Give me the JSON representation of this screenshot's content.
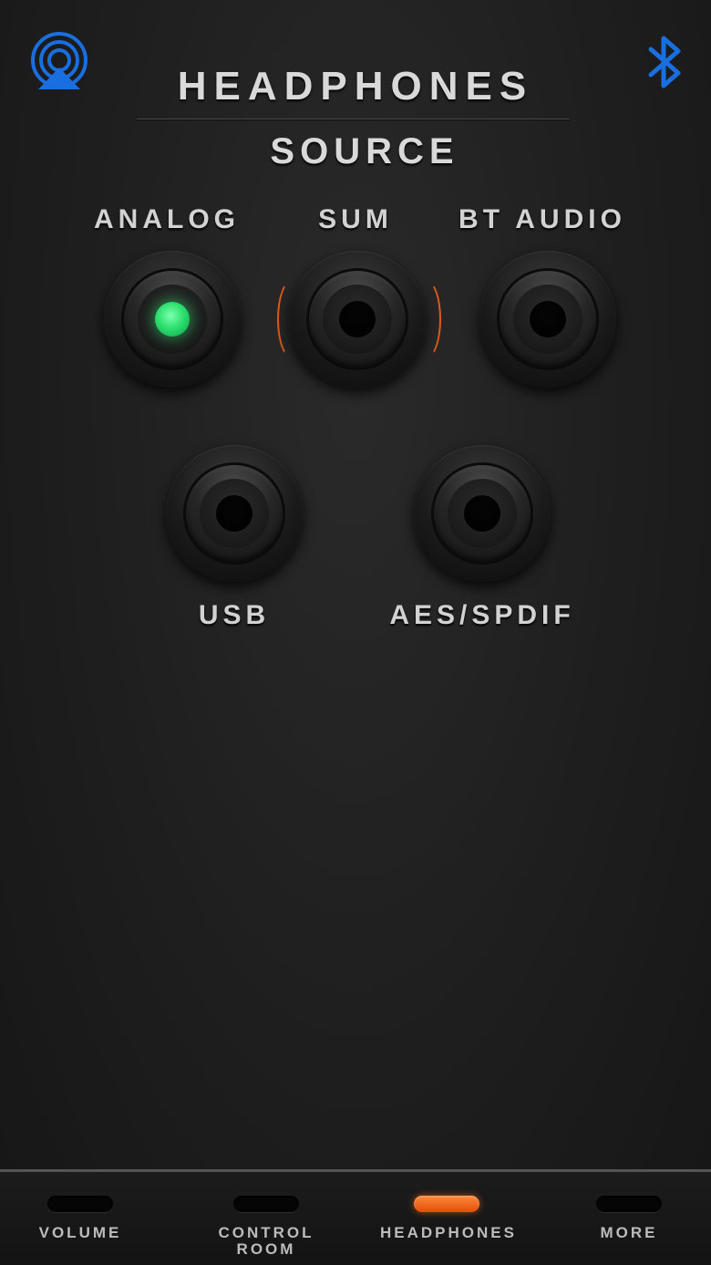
{
  "header": {
    "title": "HEADPHONES",
    "subtitle": "SOURCE"
  },
  "icons": {
    "airplay": "airplay-icon",
    "bluetooth": "bluetooth-icon"
  },
  "sources": [
    {
      "label": "ANALOG",
      "selected": true
    },
    {
      "label": "SUM",
      "selected": false,
      "highlighted": true
    },
    {
      "label": "BT AUDIO",
      "selected": false
    },
    {
      "label": "USB",
      "selected": false
    },
    {
      "label": "AES/SPDIF",
      "selected": false
    }
  ],
  "tabs": [
    {
      "label": "VOLUME",
      "active": false
    },
    {
      "label": "CONTROL\nROOM",
      "active": false
    },
    {
      "label": "HEADPHONES",
      "active": true
    },
    {
      "label": "MORE",
      "active": false
    }
  ],
  "colors": {
    "accent_blue": "#1a6fe0",
    "selected_green": "#2ee06f",
    "active_orange": "#f06a20",
    "background": "#1e1e1e"
  }
}
